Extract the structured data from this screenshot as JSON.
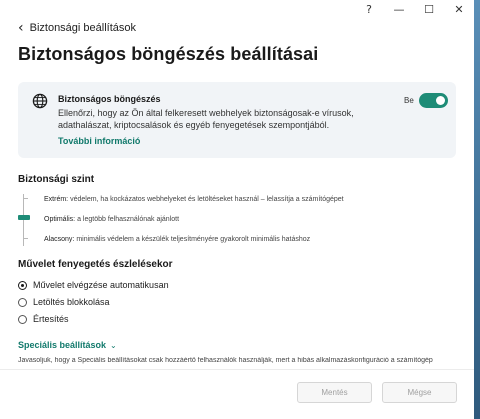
{
  "window_controls": {
    "help": "?",
    "minimize": "—",
    "maximize": "☐",
    "close": "✕"
  },
  "nav": {
    "back_glyph": "‹",
    "back_label": "Biztonsági beállítások"
  },
  "page_title": "Biztonságos böngészés beállításai",
  "feature_card": {
    "icon": "globe-icon",
    "title": "Biztonságos böngészés",
    "description": "Ellenőrzi, hogy az Ön által felkeresett webhelyek biztonságosak-e vírusok, adathalászat, kriptocsalások és egyéb fenyegetések szempontjából.",
    "more_info": "További információ",
    "toggle_label": "Be",
    "toggle_on": true
  },
  "security_level": {
    "title": "Biztonsági szint",
    "selected": "Optimális",
    "levels": [
      {
        "name": "Extrém:",
        "desc": "védelem, ha kockázatos webhelyeket és letöltéseket használ – lelassítja a számítógépet"
      },
      {
        "name": "Optimális:",
        "desc": "a legtöbb felhasználónak ajánlott"
      },
      {
        "name": "Alacsony:",
        "desc": "minimális védelem a készülék teljesítményére gyakorolt minimális hatáshoz"
      }
    ]
  },
  "action_detection": {
    "title": "Művelet fenyegetés észlelésekor",
    "options": [
      {
        "label": "Művelet elvégzése automatikusan",
        "checked": true
      },
      {
        "label": "Letöltés blokkolása",
        "checked": false
      },
      {
        "label": "Értesítés",
        "checked": false
      }
    ]
  },
  "special_settings": {
    "label": "Speciális beállítások",
    "chevron": "⌄",
    "description": "Javasoljuk, hogy a Speciális beállításokat csak hozzáértő felhasználók használják, mert a hibás alkalmazáskonfiguráció a számítógép"
  },
  "footer": {
    "save_label": "Mentés",
    "cancel_label": "Mégse"
  },
  "colors": {
    "accent": "#1e8c77",
    "link": "#127a6c",
    "card_bg": "#f1f4f7"
  }
}
